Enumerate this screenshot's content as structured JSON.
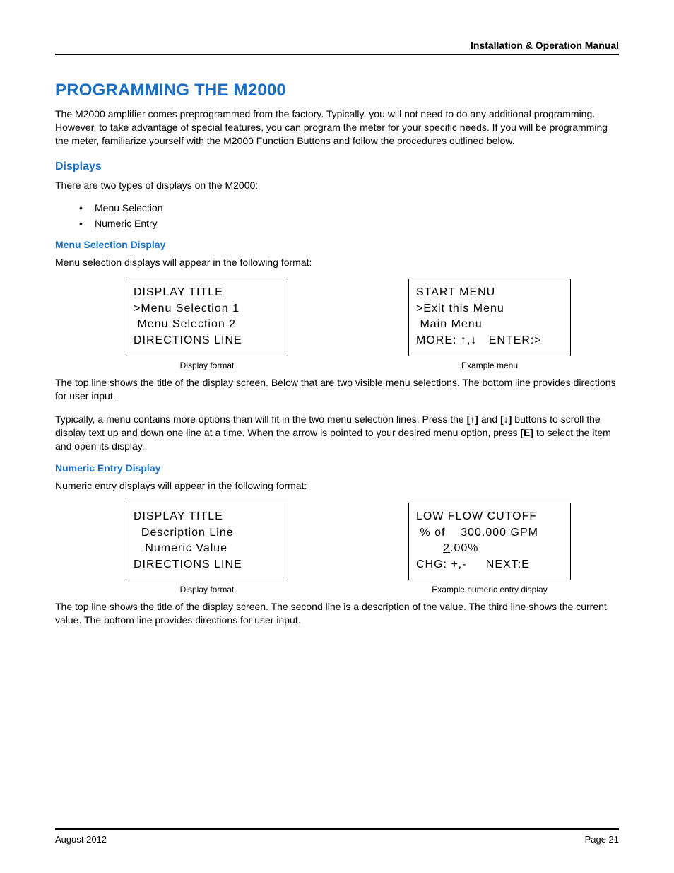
{
  "header": {
    "title": "Installation & Operation Manual"
  },
  "h1": "PROGRAMMING THE M2000",
  "intro": "The M2000 amplifier comes preprogrammed from the factory. Typically, you will not need to do any additional programming. However, to take advantage of special features, you can program the meter for your specific needs. If you will be programming the meter, familiarize yourself with the M2000 Function Buttons and follow the procedures outlined below.",
  "displays": {
    "heading": "Displays",
    "intro": "There are two types of displays on the M2000:",
    "bullets": [
      "Menu Selection",
      "Numeric Entry"
    ]
  },
  "menu_section": {
    "heading": "Menu Selection Display",
    "intro": "Menu selection displays will appear in the following format:",
    "format_box": {
      "line1": "DISPLAY TITLE",
      "line2": ">Menu Selection 1",
      "line3": " Menu Selection 2",
      "line4": "DIRECTIONS LINE"
    },
    "format_caption": "Display format",
    "example_box": {
      "line1": "START MENU",
      "line2": ">Exit this Menu",
      "line3": " Main Menu",
      "line4_left": "MORE: ",
      "line4_arrows": "↑,↓",
      "line4_right": "ENTER:>"
    },
    "example_caption": "Example menu",
    "para1": "The top line shows the title of the display screen. Below that are two visible menu selections. The bottom line provides directions for user input.",
    "para2_a": "Typically, a menu contains more options than will fit in the two menu selection lines. Press the ",
    "para2_btn1_open": "[",
    "para2_btn1_arrow": "↑",
    "para2_btn1_close": "]",
    "para2_b": " and ",
    "para2_btn2_open": "[",
    "para2_btn2_arrow": "↓",
    "para2_btn2_close": "]",
    "para2_c": " buttons to scroll the display text up and down one line at a time. When the arrow is pointed to your desired menu option, press ",
    "para2_e": "[E]",
    "para2_d": " to select the item and open its display."
  },
  "numeric_section": {
    "heading": "Numeric Entry Display",
    "intro": "Numeric entry displays will appear in the following format:",
    "format_box": {
      "line1": "DISPLAY TITLE",
      "line2": "  Description Line",
      "line3": "   Numeric Value",
      "line4": "DIRECTIONS LINE"
    },
    "format_caption": "Display format",
    "example_box": {
      "line1": "LOW FLOW CUTOFF",
      "line2": " % of    300.000 GPM",
      "line3_pre": "       ",
      "line3_u": "2",
      "line3_post": ".00%",
      "line4_left": "CHG: +,-",
      "line4_right": "NEXT:E"
    },
    "example_caption": "Example numeric entry display",
    "para1": "The top line shows the title of the display screen. The second line is a description of the value. The third line shows the current value. The bottom line provides directions for user input."
  },
  "footer": {
    "left": "August 2012",
    "right": "Page 21"
  }
}
